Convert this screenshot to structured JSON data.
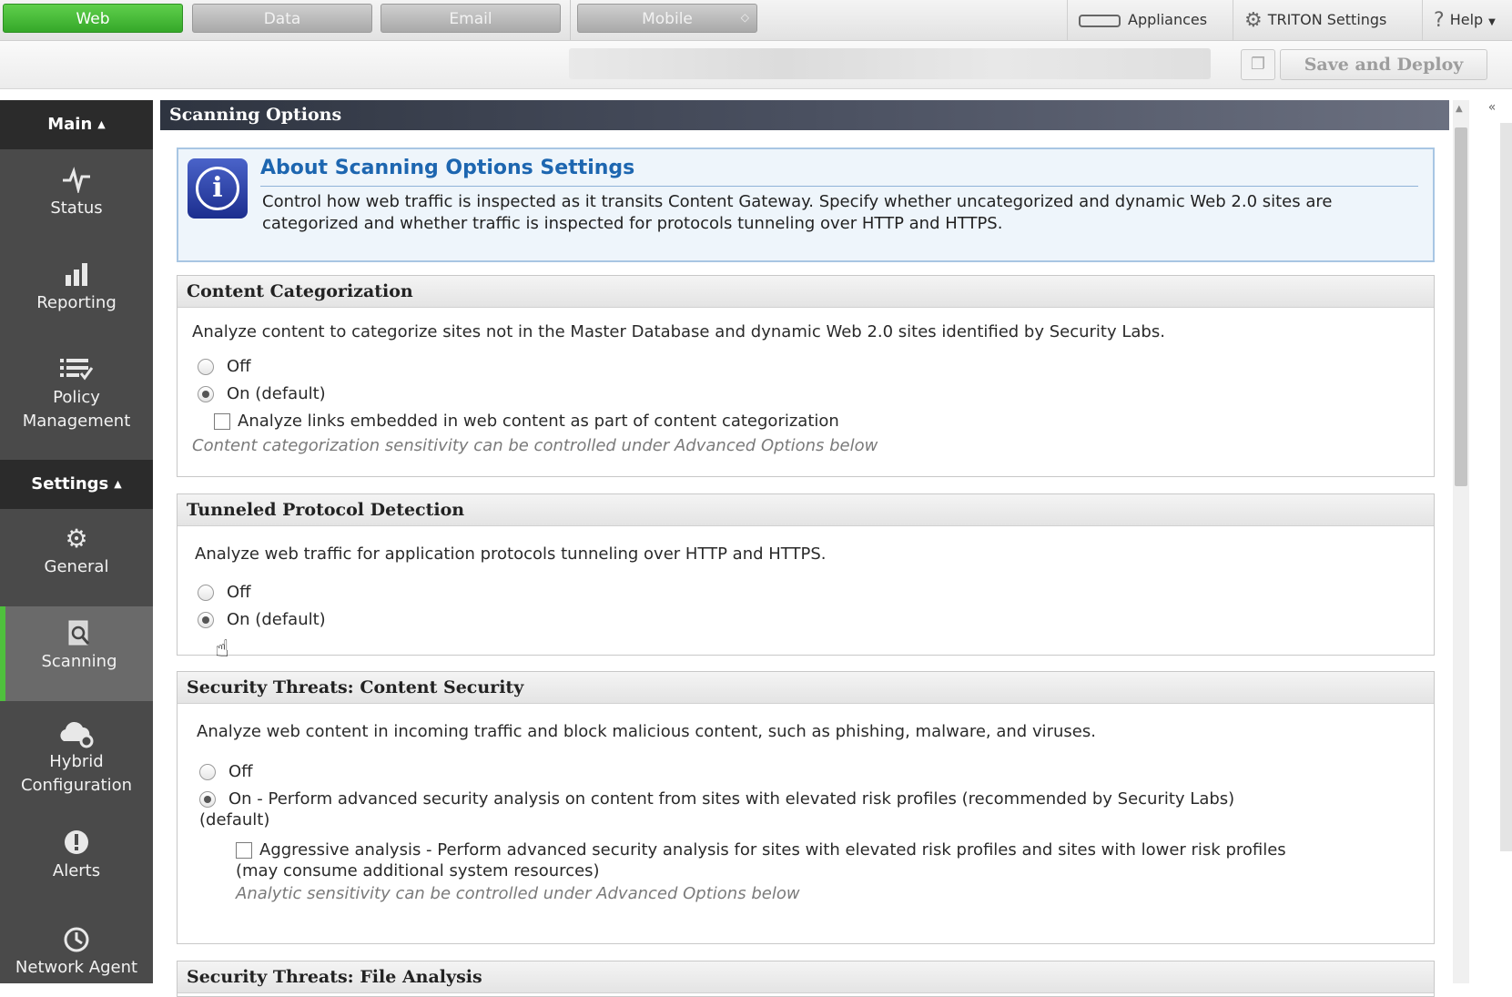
{
  "modules": [
    {
      "label": "Web",
      "active": true
    },
    {
      "label": "Data",
      "active": false
    },
    {
      "label": "Email",
      "active": false
    },
    {
      "label": "Mobile",
      "active": false
    }
  ],
  "top_links": {
    "appliances": "Appliances",
    "triton_settings": "TRITON Settings",
    "help": "Help"
  },
  "toolbar": {
    "save_deploy": "Save and Deploy"
  },
  "sidebar": {
    "main_header": "Main",
    "settings_header": "Settings",
    "main_items": [
      {
        "label": "Status",
        "icon": "pulse-icon"
      },
      {
        "label": "Reporting",
        "icon": "bar-chart-icon"
      },
      {
        "label": "Policy\nManagement",
        "icon": "policy-list-icon"
      }
    ],
    "settings_items": [
      {
        "label": "General",
        "icon": "gear-icon"
      },
      {
        "label": "Scanning",
        "icon": "scan-document-icon",
        "active": true
      },
      {
        "label": "Hybrid\nConfiguration",
        "icon": "cloud-gear-icon"
      },
      {
        "label": "Alerts",
        "icon": "alert-icon"
      },
      {
        "label": "Network Agent",
        "icon": "network-agent-icon"
      }
    ]
  },
  "page": {
    "title": "Scanning Options",
    "about": {
      "heading": "About Scanning Options Settings",
      "text": "Control how web traffic is inspected as it transits Content Gateway. Specify whether uncategorized and dynamic Web 2.0 sites are categorized and whether traffic is inspected for protocols tunneling over HTTP and HTTPS."
    },
    "content_categorization": {
      "heading": "Content Categorization",
      "description": "Analyze content to categorize sites not in the Master Database and dynamic Web 2.0 sites identified by Security Labs.",
      "options": [
        {
          "label": "Off",
          "selected": false
        },
        {
          "label": "On (default)",
          "selected": true
        }
      ],
      "checkbox": {
        "label": "Analyze links embedded in web content as part of content categorization",
        "checked": false
      },
      "note": "Content categorization sensitivity can be controlled under Advanced Options below"
    },
    "tunneled_protocol": {
      "heading": "Tunneled Protocol Detection",
      "description": "Analyze web traffic for application protocols tunneling over HTTP and HTTPS.",
      "options": [
        {
          "label": "Off",
          "selected": false
        },
        {
          "label": "On (default)",
          "selected": true
        }
      ]
    },
    "content_security": {
      "heading": "Security Threats: Content Security",
      "description": "Analyze web content in incoming traffic and block malicious content, such as phishing, malware, and viruses.",
      "options": [
        {
          "label": "Off",
          "selected": false
        },
        {
          "label": "On - Perform advanced security analysis on content from sites with elevated risk profiles (recommended by Security Labs)",
          "label_cont": "(default)",
          "selected": true
        }
      ],
      "checkbox": {
        "label": "Aggressive analysis - Perform advanced security analysis for sites with elevated risk profiles and sites with lower risk profiles",
        "label_cont": "(may consume additional system resources)",
        "checked": false
      },
      "note": "Analytic sensitivity can be controlled under Advanced Options below"
    },
    "file_analysis": {
      "heading": "Security Threats: File Analysis"
    }
  },
  "colors": {
    "active_module": "#35a829",
    "sidebar_bg": "#4a4a4a",
    "sidebar_active_accent": "#4fc03d",
    "about_heading": "#1d66b0"
  }
}
